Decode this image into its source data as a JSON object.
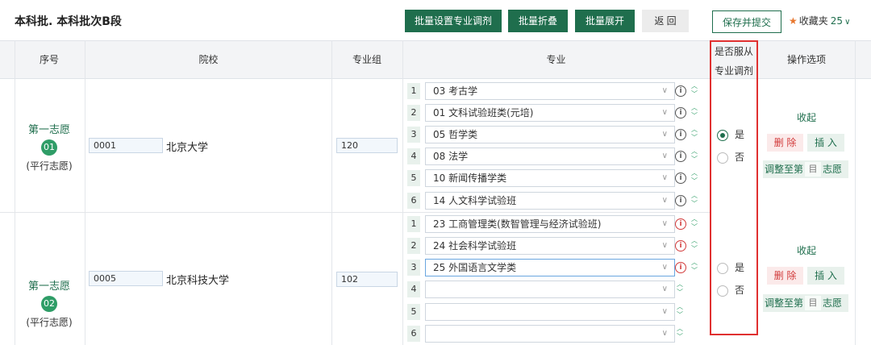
{
  "page": {
    "title": "本科批. 本科批次B段"
  },
  "toolbar": {
    "batch_adjust": "批量设置专业调剂",
    "batch_collapse": "批量折叠",
    "batch_expand": "批量展开",
    "back": "返 回",
    "save_submit": "保存并提交",
    "fav_label": "收藏夹",
    "fav_count": "25"
  },
  "header": {
    "seq": "序号",
    "school": "院校",
    "group": "专业组",
    "major": "专业",
    "adjust_l1": "是否服从",
    "adjust_l2": "专业调剂",
    "ops": "操作选项"
  },
  "radio_labels": {
    "yes": "是",
    "no": "否"
  },
  "ops": {
    "collapse": "收起",
    "delete": "删 除",
    "insert": "插 入",
    "adjust_to": "调整至第",
    "adjust_placeholder": "目",
    "adjust_suffix": "志愿"
  },
  "choices": [
    {
      "label": "第一志愿",
      "number": "01",
      "type": "(平行志愿)",
      "code": "0001",
      "university": "北京大学",
      "group": "120",
      "adjust": "yes",
      "majors": [
        {
          "idx": "1",
          "name": "03  考古学",
          "info": "black"
        },
        {
          "idx": "2",
          "name": "01  文科试验班类(元培)",
          "info": "black"
        },
        {
          "idx": "3",
          "name": "05  哲学类",
          "info": "black"
        },
        {
          "idx": "4",
          "name": "08  法学",
          "info": "black"
        },
        {
          "idx": "5",
          "name": "10  新闻传播学类",
          "info": "black"
        },
        {
          "idx": "6",
          "name": "14  人文科学试验班",
          "info": "black"
        }
      ]
    },
    {
      "label": "第一志愿",
      "number": "02",
      "type": "(平行志愿)",
      "code": "0005",
      "university": "北京科技大学",
      "group": "102",
      "adjust": "none",
      "majors": [
        {
          "idx": "1",
          "name": "23  工商管理类(数智管理与经济试验班)",
          "info": "red"
        },
        {
          "idx": "2",
          "name": "24  社会科学试验班",
          "info": "red"
        },
        {
          "idx": "3",
          "name": "25  外国语言文学类",
          "info": "red"
        },
        {
          "idx": "4",
          "name": "",
          "info": "none"
        },
        {
          "idx": "5",
          "name": "",
          "info": "none"
        },
        {
          "idx": "6",
          "name": "",
          "info": "none"
        }
      ]
    }
  ],
  "colors": {
    "brand_green": "#1f6e4d",
    "highlight_red": "#e03030",
    "delete_red": "#d23b3b"
  }
}
